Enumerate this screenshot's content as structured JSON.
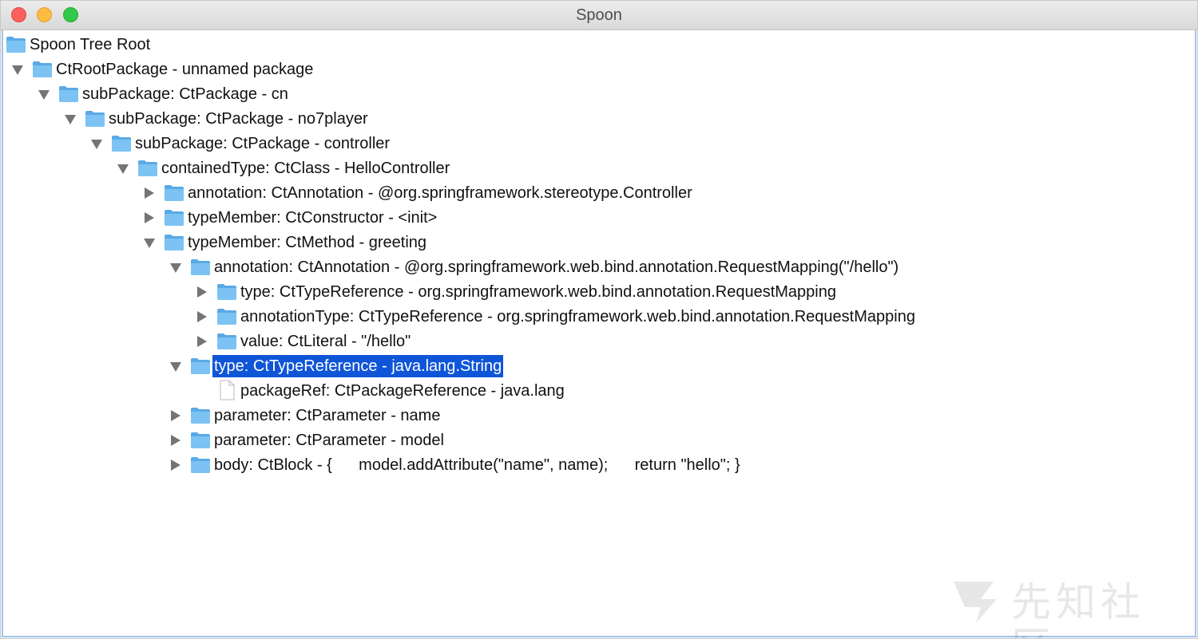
{
  "window": {
    "title": "Spoon"
  },
  "tree": {
    "nodes": [
      {
        "label": "Spoon Tree Root",
        "depth": 0,
        "expandable": false,
        "expanded": false,
        "leaf": false,
        "selected": false
      },
      {
        "label": "CtRootPackage - unnamed package",
        "depth": 1,
        "expandable": true,
        "expanded": true,
        "leaf": false,
        "selected": false
      },
      {
        "label": "subPackage: CtPackage - cn",
        "depth": 2,
        "expandable": true,
        "expanded": true,
        "leaf": false,
        "selected": false
      },
      {
        "label": "subPackage: CtPackage - no7player",
        "depth": 3,
        "expandable": true,
        "expanded": true,
        "leaf": false,
        "selected": false
      },
      {
        "label": "subPackage: CtPackage - controller",
        "depth": 4,
        "expandable": true,
        "expanded": true,
        "leaf": false,
        "selected": false
      },
      {
        "label": "containedType: CtClass - HelloController",
        "depth": 5,
        "expandable": true,
        "expanded": true,
        "leaf": false,
        "selected": false
      },
      {
        "label": "annotation: CtAnnotation - @org.springframework.stereotype.Controller",
        "depth": 6,
        "expandable": true,
        "expanded": false,
        "leaf": false,
        "selected": false
      },
      {
        "label": "typeMember: CtConstructor - <init>",
        "depth": 6,
        "expandable": true,
        "expanded": false,
        "leaf": false,
        "selected": false
      },
      {
        "label": "typeMember: CtMethod - greeting",
        "depth": 6,
        "expandable": true,
        "expanded": true,
        "leaf": false,
        "selected": false
      },
      {
        "label": "annotation: CtAnnotation - @org.springframework.web.bind.annotation.RequestMapping(\"/hello\")",
        "depth": 7,
        "expandable": true,
        "expanded": true,
        "leaf": false,
        "selected": false
      },
      {
        "label": "type: CtTypeReference - org.springframework.web.bind.annotation.RequestMapping",
        "depth": 8,
        "expandable": true,
        "expanded": false,
        "leaf": false,
        "selected": false
      },
      {
        "label": "annotationType: CtTypeReference - org.springframework.web.bind.annotation.RequestMapping",
        "depth": 8,
        "expandable": true,
        "expanded": false,
        "leaf": false,
        "selected": false
      },
      {
        "label": "value: CtLiteral - \"/hello\"",
        "depth": 8,
        "expandable": true,
        "expanded": false,
        "leaf": false,
        "selected": false
      },
      {
        "label": "type: CtTypeReference - java.lang.String",
        "depth": 7,
        "expandable": true,
        "expanded": true,
        "leaf": false,
        "selected": true
      },
      {
        "label": "packageRef: CtPackageReference - java.lang",
        "depth": 8,
        "expandable": false,
        "expanded": false,
        "leaf": true,
        "selected": false
      },
      {
        "label": "parameter: CtParameter - name",
        "depth": 7,
        "expandable": true,
        "expanded": false,
        "leaf": false,
        "selected": false
      },
      {
        "label": "parameter: CtParameter - model",
        "depth": 7,
        "expandable": true,
        "expanded": false,
        "leaf": false,
        "selected": false
      },
      {
        "label": "body: CtBlock - {      model.addAttribute(\"name\", name);      return \"hello\"; }",
        "depth": 7,
        "expandable": true,
        "expanded": false,
        "leaf": false,
        "selected": false
      }
    ]
  },
  "watermark": {
    "text": "先知社区"
  },
  "colors": {
    "selection": "#0f55d8",
    "folder_fill": "#7cc3f3",
    "folder_back": "#5aa9e6",
    "triangle": "#747474"
  }
}
